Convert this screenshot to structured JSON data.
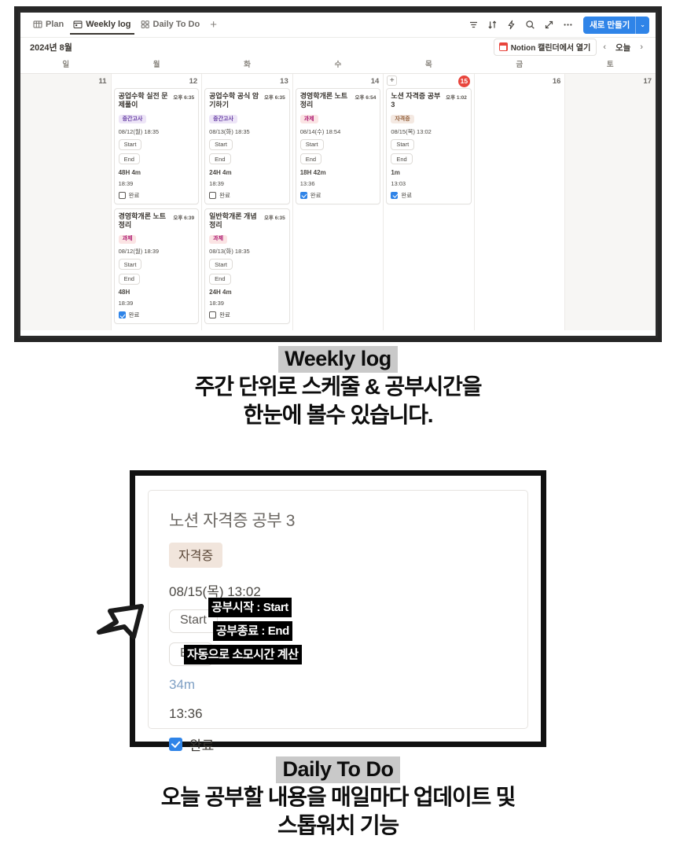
{
  "screenshot1": {
    "tabs": [
      {
        "label": "Plan",
        "icon": "table-icon",
        "active": false
      },
      {
        "label": "Weekly log",
        "icon": "calendar-icon",
        "active": true
      },
      {
        "label": "Daily To Do",
        "icon": "gallery-icon",
        "active": false
      }
    ],
    "add_tab_label": "+",
    "toolbar_icons": [
      "filter-icon",
      "sort-icon",
      "automation-icon",
      "search-icon",
      "expand-icon",
      "more-icon"
    ],
    "new_button": {
      "label": "새로 만들기",
      "chevron": "⌄",
      "color": "#2f84e8"
    },
    "month_label": "2024년 8월",
    "open_in_notion_calendar": "Notion 캘린더에서 열기",
    "nav": {
      "prev": "‹",
      "today": "오늘",
      "next": "›"
    },
    "weekdays": [
      "일",
      "월",
      "화",
      "수",
      "목",
      "금",
      "토"
    ],
    "days": [
      {
        "num": "11",
        "weekend": true,
        "today": false,
        "add": false,
        "events": []
      },
      {
        "num": "12",
        "weekend": false,
        "today": false,
        "add": false,
        "events": [
          0,
          4
        ]
      },
      {
        "num": "13",
        "weekend": false,
        "today": false,
        "add": false,
        "events": [
          1,
          5
        ]
      },
      {
        "num": "14",
        "weekend": false,
        "today": false,
        "add": false,
        "events": [
          2
        ]
      },
      {
        "num": "15",
        "weekend": false,
        "today": true,
        "add": true,
        "events": [
          3
        ]
      },
      {
        "num": "16",
        "weekend": false,
        "today": false,
        "add": false,
        "events": []
      },
      {
        "num": "17",
        "weekend": true,
        "today": false,
        "add": false,
        "events": []
      }
    ],
    "events": [
      {
        "title": "공업수학 실전 문제풀이",
        "time": "오후 6:35",
        "tag": "중간고사",
        "tag_bg": "#ede5f7",
        "tag_fg": "#6940a5",
        "date": "08/12(월) 18:35",
        "start_label": "Start",
        "end_label": "End",
        "duration": "48H 4m",
        "end_time": "18:39",
        "done_label": "완료",
        "done": false
      },
      {
        "title": "공업수학 공식 암기하기",
        "time": "오후 6:35",
        "tag": "중간고사",
        "tag_bg": "#ede5f7",
        "tag_fg": "#6940a5",
        "date": "08/13(화) 18:35",
        "start_label": "Start",
        "end_label": "End",
        "duration": "24H 4m",
        "end_time": "18:39",
        "done_label": "완료",
        "done": false
      },
      {
        "title": "경영학개론 노트정리",
        "time": "오후 6:54",
        "tag": "과제",
        "tag_bg": "#fbe4e4",
        "tag_fg": "#ad1a72",
        "date": "08/14(수) 18:54",
        "start_label": "Start",
        "end_label": "End",
        "duration": "18H 42m",
        "end_time": "13:36",
        "done_label": "완료",
        "done": true
      },
      {
        "title": "노션 자격증 공부 3",
        "time": "오후 1:02",
        "tag": "자격증",
        "tag_bg": "#f4e9e2",
        "tag_fg": "#93603b",
        "date": "08/15(목) 13:02",
        "start_label": "Start",
        "end_label": "End",
        "duration": "1m",
        "end_time": "13:03",
        "done_label": "완료",
        "done": true
      },
      {
        "title": "경영학개론 노트정리",
        "time": "오후 6:39",
        "tag": "과제",
        "tag_bg": "#fbe4e4",
        "tag_fg": "#ad1a72",
        "date": "08/12(월) 18:39",
        "start_label": "Start",
        "end_label": "End",
        "duration": "48H",
        "end_time": "18:39",
        "done_label": "완료",
        "done": true
      },
      {
        "title": "일반학개론 개념정리",
        "time": "오후 6:35",
        "tag": "과제",
        "tag_bg": "#fbe4e4",
        "tag_fg": "#ad1a72",
        "date": "08/13(화) 18:35",
        "start_label": "Start",
        "end_label": "End",
        "duration": "24H 4m",
        "end_time": "18:39",
        "done_label": "완료",
        "done": false
      }
    ]
  },
  "caption1": {
    "badge": "Weekly log",
    "line1": "주간 단위로 스케줄 & 공부시간을",
    "line2": "한눈에 볼수 있습니다."
  },
  "screenshot2": {
    "title": "노션 자격증 공부 3",
    "tag": "자격증",
    "date": "08/15(목) 13:02",
    "start_label": "Start",
    "end_label": "End",
    "duration": "34m",
    "end_time": "13:36",
    "done_label": "완료",
    "annotations": [
      "공부시작 : Start",
      "공부종료 : End",
      "자동으로 소모시간 계산"
    ]
  },
  "caption2": {
    "badge": "Daily To Do",
    "line1": "오늘 공부할 내용을 매일마다 업데이트 및",
    "line2": "스톱워치 기능"
  }
}
